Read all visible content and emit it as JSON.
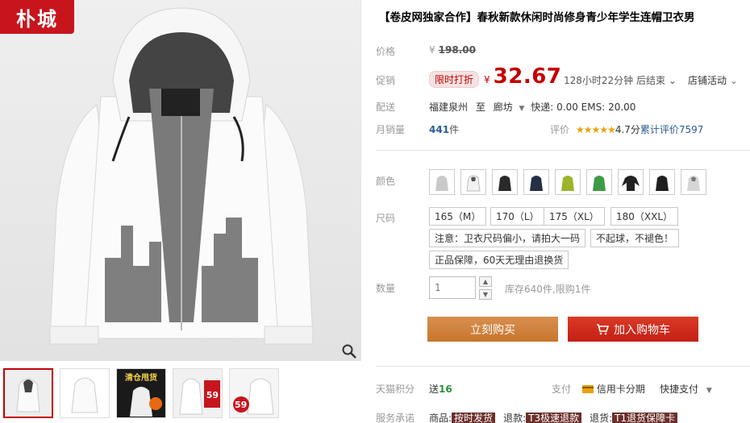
{
  "gallery": {
    "brand_badge": "朴城",
    "thumbs": [
      {
        "tag": "",
        "label": ""
      },
      {
        "tag": "",
        "label": ""
      },
      {
        "tag": "",
        "label": "清仓甩货"
      },
      {
        "tag": "",
        "label": "59"
      },
      {
        "tag": "",
        "label": "59"
      }
    ]
  },
  "product": {
    "title": "【卷皮网独家合作】春秋新款休闲时尚修身青少年学生连帽卫衣男",
    "price_label": "价格",
    "original_price_yen": "¥",
    "original_price": "198.00",
    "promo_label": "促销",
    "promo_tag": "限时打折",
    "sale_price_yen": "¥",
    "sale_price": "32.67",
    "countdown": "128小时22分钟 后结束",
    "countdown_caret": "⌄",
    "shop_activity": "店铺活动",
    "shipping_label": "配送",
    "ship_from": "福建泉州",
    "ship_to_word": "至",
    "ship_to": "廊坊",
    "ship_fees": "快递: 0.00 EMS: 20.00",
    "monthly_label": "月销量",
    "monthly_sales": "441",
    "monthly_unit": "件",
    "rating_label": "评价",
    "rating_stars": "★★★★★",
    "rating_score": "4.7分",
    "rating_count": "累计评价7597"
  },
  "options": {
    "color_label": "颜色",
    "colors": [
      "light-gray",
      "white",
      "black",
      "navy",
      "lime",
      "green",
      "black-hooded",
      "black",
      "gray"
    ],
    "size_label": "尺码",
    "sizes": [
      "165（M）",
      "170（L）",
      "175（XL）",
      "180（XXL）"
    ],
    "notes": [
      "注意：卫衣尺码偏小，请拍大一码",
      "不起球，不褪色！",
      "正品保障，60天无理由退换货"
    ],
    "qty_label": "数量",
    "qty_value": "1",
    "stock_text": "库存640件,限购1件"
  },
  "actions": {
    "buy_now": "立刻购买",
    "add_cart": "加入购物车"
  },
  "footer": {
    "points_label": "天猫积分",
    "points_text": "送",
    "points_value": "16",
    "pay_label": "支付",
    "credit_text": "信用卡分期",
    "quick_pay": "快捷支付",
    "promise_label": "服务承诺",
    "promise_1_prefix": "商品:",
    "promise_1_tag": "按时发货",
    "promise_2_prefix": "退款:",
    "promise_2_tag": "T3极速退款",
    "promise_3_prefix": "退货:",
    "promise_3_tag": "T1退货保障卡"
  }
}
